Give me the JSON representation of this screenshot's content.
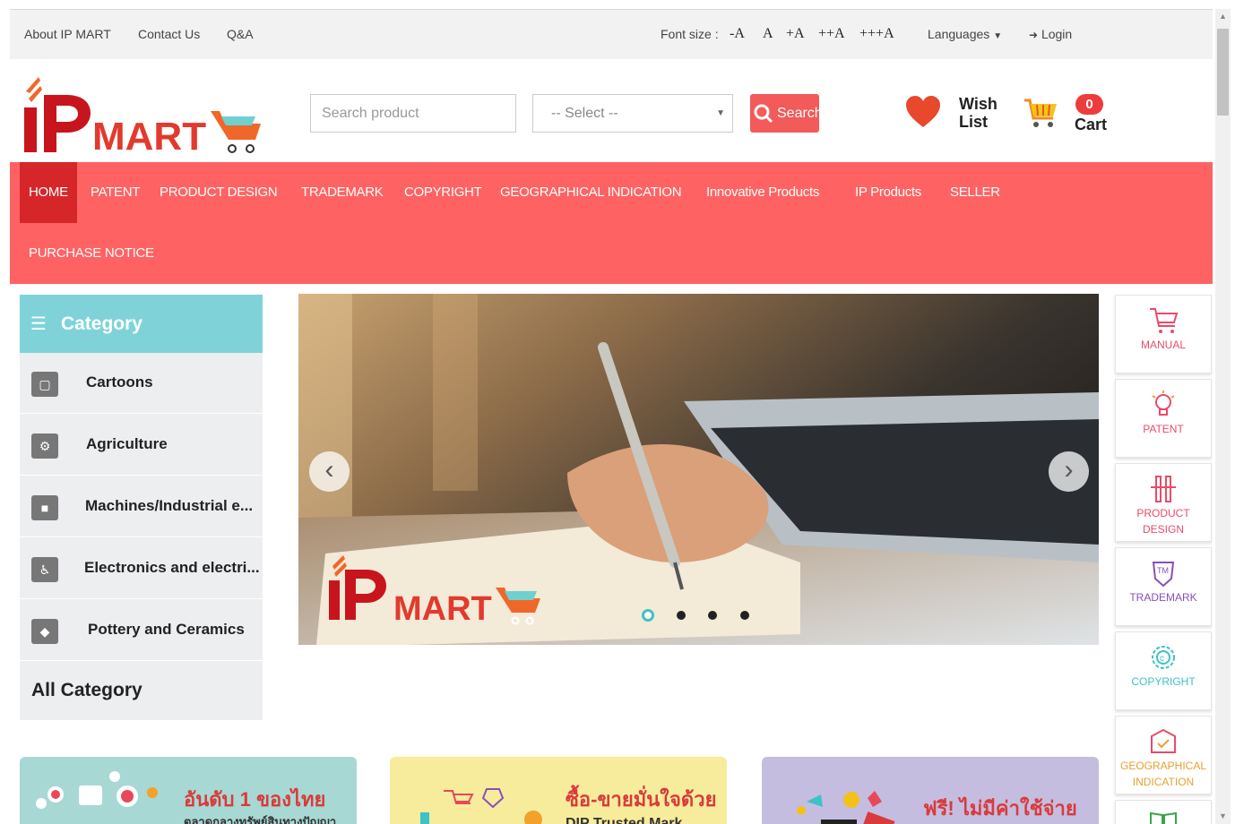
{
  "topbar": {
    "about": "About IP MART",
    "contact": "Contact Us",
    "qa": "Q&A",
    "font_size_label": "Font size :",
    "font_minus": "-A",
    "font_normal": "A",
    "font_plus": "+A",
    "font_plus2": "++A",
    "font_plus3": "+++A",
    "languages": "Languages",
    "login": "Login"
  },
  "header": {
    "logo_text_ip": "iP",
    "logo_text_mart": "MART",
    "search_placeholder": "Search product",
    "select_value": "-- Select --",
    "search_button": "Search",
    "wishlist_label_1": "Wish",
    "wishlist_label_2": "List",
    "cart_count": "0",
    "cart_label": "Cart"
  },
  "nav": {
    "items": [
      "HOME",
      "PATENT",
      "PRODUCT DESIGN",
      "TRADEMARK",
      "COPYRIGHT",
      "GEOGRAPHICAL INDICATION",
      "Innovative Products",
      "IP Products",
      "SELLER",
      "PURCHASE NOTICE"
    ],
    "active": "HOME"
  },
  "category": {
    "title": "Category",
    "items": [
      {
        "label": "Cartoons",
        "icon": "monitor-icon"
      },
      {
        "label": "Agriculture",
        "icon": "gears-icon"
      },
      {
        "label": "Machines/Industrial e...",
        "icon": "bag-icon"
      },
      {
        "label": "Electronics and electri...",
        "icon": "wheelchair-icon"
      },
      {
        "label": "Pottery and Ceramics",
        "icon": "diamond-icon"
      }
    ],
    "all_label": "All Category"
  },
  "banner": {
    "logo_ip": "iP",
    "logo_mart": "MART",
    "slide_count": 4,
    "active_slide": 1
  },
  "quick_menu": [
    {
      "label": "MANUAL",
      "icon": "cart-outline-icon"
    },
    {
      "label": "PATENT",
      "icon": "lightbulb-icon"
    },
    {
      "label": "PRODUCT DESIGN",
      "icon": "design-tool-icon"
    },
    {
      "label": "TRADEMARK",
      "icon": "trademark-badge-icon"
    },
    {
      "label": "COPYRIGHT",
      "icon": "copyright-gear-icon"
    },
    {
      "label": "GEOGRAPHICAL INDICATION",
      "icon": "map-box-icon"
    }
  ],
  "promos": [
    {
      "title": "อันดับ 1 ของไทย",
      "subtitle": "ตลาดกลางทรัพย์สินทางปัญญา",
      "bg": "#a8d8d4"
    },
    {
      "title": "ซื้อ-ขายมั่นใจด้วย",
      "subtitle": "DIP Trusted Mark",
      "bg": "#f6ec9c"
    },
    {
      "title": "ฟรี! ไม่มีค่าใช้จ่าย",
      "subtitle": "",
      "bg": "#c4bde0"
    }
  ],
  "colors": {
    "brand_red": "#ff6262",
    "active_nav": "#d6262a",
    "category_header": "#7fd3d8",
    "accent_teal": "#3ec1c7"
  }
}
